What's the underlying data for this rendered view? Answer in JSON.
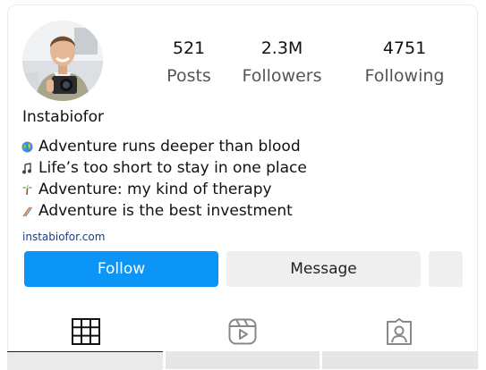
{
  "stats": {
    "posts": {
      "value": "521",
      "label": "Posts"
    },
    "followers": {
      "value": "2.3M",
      "label": "Followers"
    },
    "following": {
      "value": "4751",
      "label": "Following"
    }
  },
  "profile": {
    "username": "Instabiofor",
    "bio": [
      {
        "icon": "globe-icon",
        "text": "Adventure runs deeper than blood"
      },
      {
        "icon": "music-note-icon",
        "text": "Life’s too short to stay in one place"
      },
      {
        "icon": "palm-tree-icon",
        "text": "Adventure: my kind of therapy"
      },
      {
        "icon": "rainbow-icon",
        "text": "Adventure is the best investment"
      }
    ],
    "link": "instabiofor.com"
  },
  "actions": {
    "follow_label": "Follow",
    "message_label": "Message"
  },
  "tabs": [
    {
      "name": "posts-grid",
      "icon": "grid-icon",
      "active": true
    },
    {
      "name": "reels",
      "icon": "reels-icon",
      "active": false
    },
    {
      "name": "tagged",
      "icon": "tagged-user-icon",
      "active": false
    }
  ],
  "colors": {
    "follow_button": "#0b95f6",
    "secondary_button": "#efefef",
    "link": "#1c3d7a"
  }
}
